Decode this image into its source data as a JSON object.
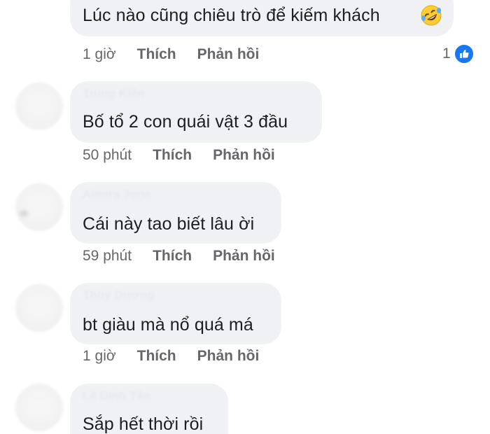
{
  "comments": [
    {
      "author": "",
      "text": "Lúc nào cũng chiêu trò để kiếm khách",
      "emoji": "rolling-on-floor-laughing",
      "time": "1 giờ",
      "like_label": "Thích",
      "reply_label": "Phản hồi",
      "reaction_count": "1",
      "reaction_icon": "like-icon"
    },
    {
      "author": "Trung Kiên",
      "text": "Bố tổ 2 con quái vật 3 đầu",
      "time": "50 phút",
      "like_label": "Thích",
      "reply_label": "Phản hồi"
    },
    {
      "author": "Aimira Jona",
      "text": "Cái này tao biết lâu ời",
      "time": "59 phút",
      "like_label": "Thích",
      "reply_label": "Phản hồi"
    },
    {
      "author": "Thùy Dương",
      "text": "bt giàu mà nổ quá má",
      "time": "1 giờ",
      "like_label": "Thích",
      "reply_label": "Phản hồi"
    },
    {
      "author": "Lê Đình Tân",
      "text": "Sắp hết thời rồi"
    }
  ],
  "colors": {
    "bubble": "#eff1f4",
    "text": "#1c1e21",
    "meta": "#65676b",
    "like_blue": "#1877f2"
  }
}
